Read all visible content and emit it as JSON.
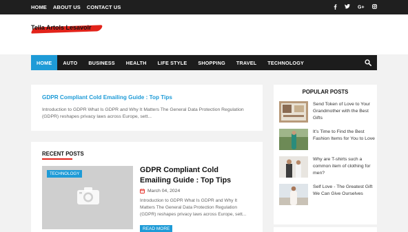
{
  "topbar": {
    "links": [
      "HOME",
      "ABOUT US",
      "CONTACT US"
    ],
    "social": [
      "f",
      "t",
      "G+",
      "ig"
    ]
  },
  "brand": {
    "logo_text": "Tella Artols Lesavoir"
  },
  "nav": {
    "items": [
      "HOME",
      "AUTO",
      "BUSINESS",
      "HEALTH",
      "LIFE STYLE",
      "SHOPPING",
      "TRAVEL",
      "TECHNOLOGY"
    ],
    "active_index": 0
  },
  "featured": {
    "title": "GDPR Compliant Cold Emailing Guide : Top Tips",
    "excerpt": "Introduction to GDPR What Is GDPR and Why It Matters The General Data Protection Regulation (GDPR) reshapes privacy laws across Europe, sett..."
  },
  "recent": {
    "heading": "RECENT POSTS",
    "post": {
      "category": "TECHNOLOGY",
      "title": "GDPR Compliant Cold Emailing Guide : Top Tips",
      "date": "March 04, 2024",
      "excerpt": "Introduction to GDPR What Is GDPR and Why It Matters The General Data Protection Regulation (GDPR) reshapes privacy laws across Europe, sett...",
      "read_more": "READ MORE"
    }
  },
  "popular": {
    "heading": "POPULAR POSTS",
    "items": [
      {
        "title": "Send Token of Love to Your Grandmother with the Best Gifts"
      },
      {
        "title": "It’s Time to Find the Best Fashion Items for You to Love"
      },
      {
        "title": "Why are T-shirts such a common item of clothing for men?"
      },
      {
        "title": "Self Love - The Greatest Gift We Can Give Ourselves"
      }
    ]
  },
  "colors": {
    "accent": "#1e9bd7",
    "dark": "#1c1c1c",
    "red": "#e2231a"
  }
}
